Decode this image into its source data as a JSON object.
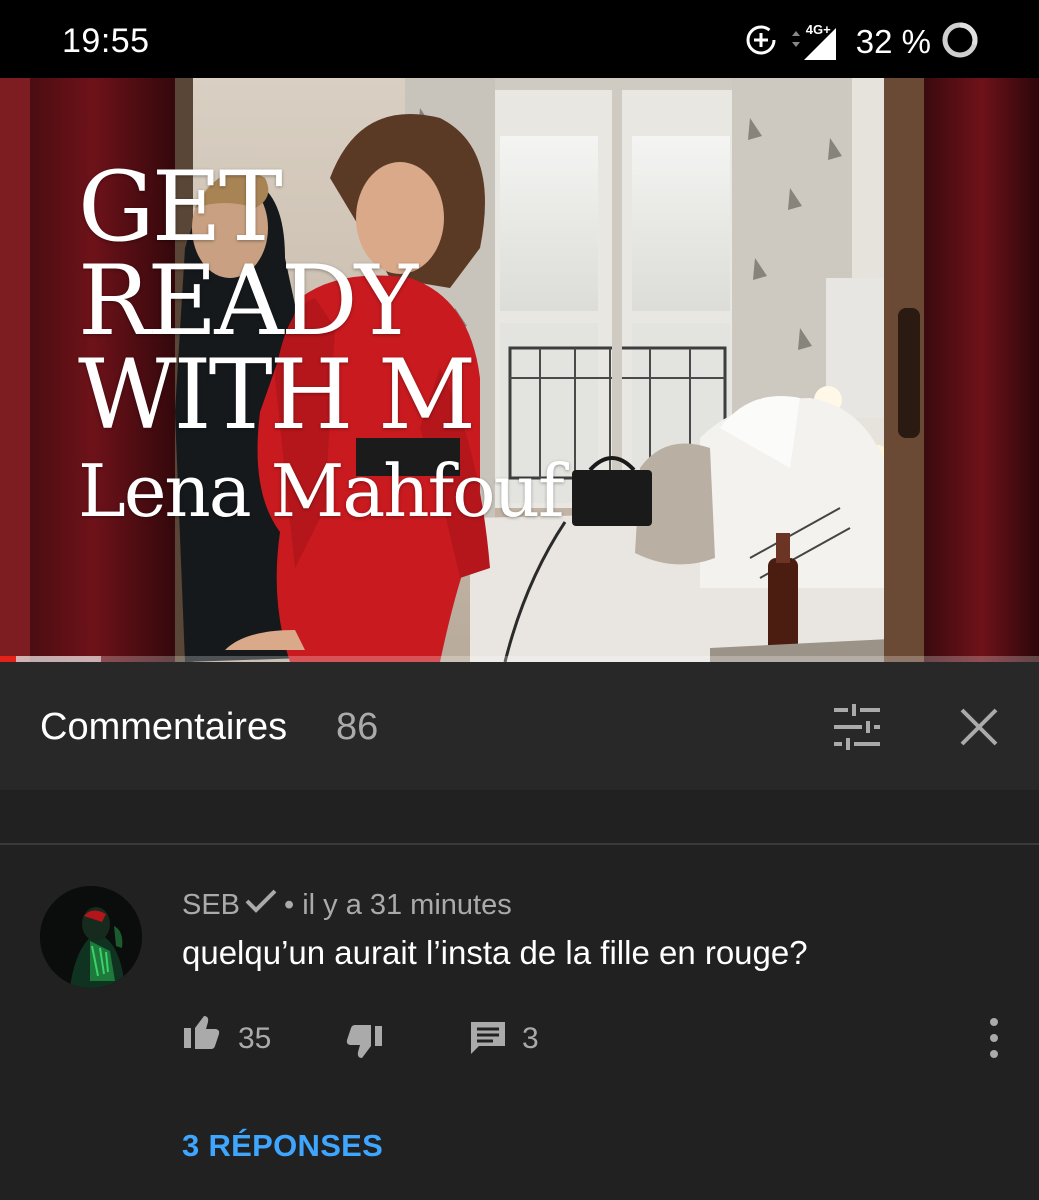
{
  "status_bar": {
    "time": "19:55",
    "network": "4G+",
    "battery": "32 %"
  },
  "video": {
    "title_lines": [
      "GET",
      "READY",
      "WITH M"
    ],
    "title_subline": "Lena Mahfouf",
    "progress_played": 0.015,
    "progress_buffered": 0.097
  },
  "comments": {
    "title": "Commentaires",
    "count": "86"
  },
  "comment": {
    "author": "SEB",
    "time": "il y a 31 minutes",
    "separator": "•",
    "text": "quelqu’un aurait l’insta de la fille en rouge?",
    "likes": "35",
    "replies_count": "3",
    "replies_link": "3 RÉPONSES"
  },
  "colors": {
    "background": "#212121",
    "header_bg": "#282828",
    "link": "#3ea6ff",
    "progress": "#e62117"
  },
  "icons": [
    "add-circle-icon",
    "signal-icon",
    "battery-icon",
    "sort-sliders-icon",
    "close-icon",
    "thumbs-up-icon",
    "thumbs-down-icon",
    "reply-icon",
    "more-vertical-icon",
    "verified-check-icon"
  ]
}
